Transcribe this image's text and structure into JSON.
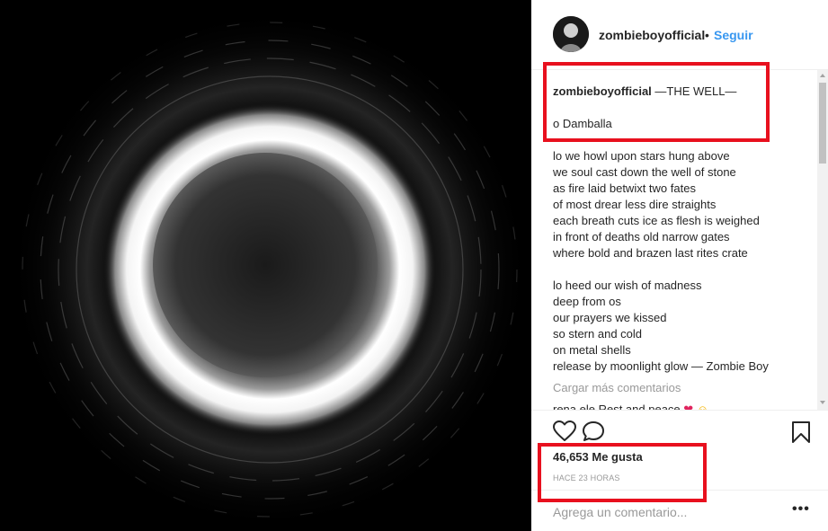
{
  "post": {
    "image_icon": "eclipse-ring-image"
  },
  "header": {
    "username": "zombieboyofficial",
    "separator": "•",
    "follow_label": "Seguir",
    "follow_color": "#3897f0"
  },
  "caption": {
    "username": "zombieboyofficial",
    "title": "—THE WELL—",
    "lines": [
      "o Damballa",
      "",
      "lo we howl upon stars hung above",
      "we soul cast down the well of stone",
      "as fire laid betwixt two fates",
      "of most drear less dire straights",
      "each breath cuts ice as flesh is weighed",
      "in front of deaths old narrow gates",
      "where bold and brazen last rites crate",
      "",
      "lo heed our wish of madness",
      "deep from os",
      "our prayers we kissed",
      "so stern and cold",
      "on metal shells",
      "release by moonlight glow — Zombie Boy"
    ]
  },
  "comments": {
    "load_more_label": "Cargar más comentarios",
    "partial_comment_text": "rena ele Rest and peace",
    "partial_emojis": [
      "❤",
      "☺"
    ]
  },
  "actions": {
    "like_icon": "heart-outline-icon",
    "comment_icon": "speech-bubble-icon",
    "save_icon": "bookmark-icon"
  },
  "likes": {
    "label": "46,653 Me gusta"
  },
  "timestamp": {
    "label": "HACE 23 HORAS"
  },
  "add_comment": {
    "placeholder": "Agrega un comentario...",
    "more_label": "•••"
  },
  "annotations": {
    "highlight_color": "#e8101e"
  }
}
